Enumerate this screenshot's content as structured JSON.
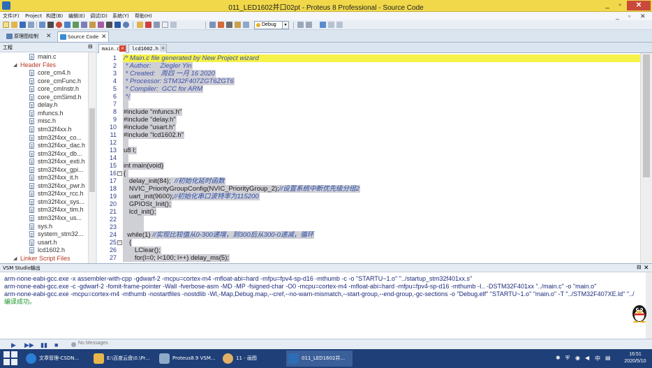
{
  "window": {
    "title": "011_LED1602并口02pt - Proteus 8 Professional - Source Code",
    "min": "_",
    "max": "▫",
    "close": "✕"
  },
  "menu": {
    "items": [
      "文件(F)",
      "Project",
      "构建(B)",
      "编辑(E)",
      "调试(D)",
      "系统(Y)",
      "帮助(H)"
    ],
    "mdi": [
      "_",
      "▫",
      "✕"
    ]
  },
  "toolbar": {
    "dropdown": "Debug",
    "arrow": "▾"
  },
  "doctabs": [
    {
      "label": "原理图绘制",
      "close": "✕",
      "color": "#5a7fb3"
    },
    {
      "label": "Source Code",
      "close": "✕",
      "color": "#3a8bd0"
    }
  ],
  "project": {
    "header": "工程",
    "pin": "⊟",
    "items": [
      {
        "label": "main.c",
        "type": "file",
        "indent": 0
      },
      {
        "label": "Header Files",
        "type": "folder",
        "indent": 0
      },
      {
        "label": "core_cm4.h",
        "type": "file",
        "indent": 1
      },
      {
        "label": "core_cmFunc.h",
        "type": "file",
        "indent": 1
      },
      {
        "label": "core_cmInstr.h",
        "type": "file",
        "indent": 1
      },
      {
        "label": "core_cmSimd.h",
        "type": "file",
        "indent": 1
      },
      {
        "label": "delay.h",
        "type": "file",
        "indent": 1
      },
      {
        "label": "mfuncs.h",
        "type": "file",
        "indent": 1
      },
      {
        "label": "misc.h",
        "type": "file",
        "indent": 1
      },
      {
        "label": "stm32f4xx.h",
        "type": "file",
        "indent": 1
      },
      {
        "label": "stm32f4xx_co...",
        "type": "file",
        "indent": 1
      },
      {
        "label": "stm32f4xx_dac.h",
        "type": "file",
        "indent": 1
      },
      {
        "label": "stm32f4xx_db...",
        "type": "file",
        "indent": 1
      },
      {
        "label": "stm32f4xx_exti.h",
        "type": "file",
        "indent": 1
      },
      {
        "label": "stm32f4xx_gpi...",
        "type": "file",
        "indent": 1
      },
      {
        "label": "stm32f4xx_it.h",
        "type": "file",
        "indent": 1
      },
      {
        "label": "stm32f4xx_pwr.h",
        "type": "file",
        "indent": 1
      },
      {
        "label": "stm32f4xx_rcc.h",
        "type": "file",
        "indent": 1
      },
      {
        "label": "stm32f4xx_sys...",
        "type": "file",
        "indent": 1
      },
      {
        "label": "stm32f4xx_tim.h",
        "type": "file",
        "indent": 1
      },
      {
        "label": "stm32f4xx_us...",
        "type": "file",
        "indent": 1
      },
      {
        "label": "sys.h",
        "type": "file",
        "indent": 1
      },
      {
        "label": "system_stm32...",
        "type": "file",
        "indent": 1
      },
      {
        "label": "usart.h",
        "type": "file",
        "indent": 1
      },
      {
        "label": "lcd1602.h",
        "type": "file",
        "indent": 1
      },
      {
        "label": "Linker Script Files",
        "type": "folder",
        "indent": 0
      }
    ]
  },
  "editor_tabs": [
    {
      "label": "main.c",
      "close": "✕",
      "active": true
    },
    {
      "label": "lcd1602.h",
      "close": "✕",
      "active": false
    }
  ],
  "code": [
    {
      "n": "1",
      "text": "/* Main.c file generated by New Project wizard",
      "k": "cm",
      "cur": true
    },
    {
      "n": "2",
      "text": " * Author:     Ziegler Yin",
      "k": "cm"
    },
    {
      "n": "3",
      "text": " * Created:   周四 一月 16 2020",
      "k": "cm"
    },
    {
      "n": "4",
      "text": " * Processor: STM32F407ZGT6ZGT6",
      "k": "cm"
    },
    {
      "n": "5",
      "text": " * Compiler:  GCC for ARM",
      "k": "cm"
    },
    {
      "n": "6",
      "text": " */",
      "k": "cm"
    },
    {
      "n": "7",
      "text": "",
      "k": "nm"
    },
    {
      "n": "8",
      "text": "#include \"mfuncs.h\"",
      "k": "pp"
    },
    {
      "n": "9",
      "text": "#include \"delay.h\"",
      "k": "pp"
    },
    {
      "n": "10",
      "text": "#include \"usart.h\"",
      "k": "pp"
    },
    {
      "n": "11",
      "text": "#include \"lcd1602.h\"",
      "k": "pp"
    },
    {
      "n": "12",
      "text": "",
      "k": "nm"
    },
    {
      "n": "13",
      "text": "u8 l;",
      "k": "nm"
    },
    {
      "n": "14",
      "text": "",
      "k": "nm"
    },
    {
      "n": "15",
      "text": "int main(void)",
      "k": "nm"
    },
    {
      "n": "16",
      "text": "{",
      "k": "nm",
      "fold": "⊟"
    },
    {
      "n": "17",
      "text": "   delay_init(84);  //初始化延时函数",
      "k": "mx"
    },
    {
      "n": "18",
      "text": "   NVIC_PriorityGroupConfig(NVIC_PriorityGroup_2);//设置系统中断优先级分组2",
      "k": "mx"
    },
    {
      "n": "19",
      "text": "   uart_init(9600);//初始化串口波特率为115200",
      "k": "mx"
    },
    {
      "n": "20",
      "text": "   GPIOSt_Init();",
      "k": "nm"
    },
    {
      "n": "21",
      "text": "   lcd_init();",
      "k": "nm"
    },
    {
      "n": "22",
      "text": "",
      "k": "nm"
    },
    {
      "n": "23",
      "text": "",
      "k": "nm"
    },
    {
      "n": "24",
      "text": "  while(1) //实现比较值从0-300递增，到300后从300-0递减，循环",
      "k": "mx"
    },
    {
      "n": "25",
      "text": "   {",
      "k": "nm",
      "fold": "⊟"
    },
    {
      "n": "26",
      "text": "      LClear();",
      "k": "nm"
    },
    {
      "n": "27",
      "text": "      for(l=0; l<100; l++) delay_ms(5);",
      "k": "nm"
    }
  ],
  "output": {
    "header": "VSM Studio输出",
    "pin": "⊟",
    "close": "✕",
    "lines": [
      "arm-none-eabi-gcc.exe -x assembler-with-cpp -gdwarf-2 -mcpu=cortex-m4 -mfloat-abi=hard -mfpu=fpv4-sp-d16 -mthumb -c  -o \"STARTU~1.o\" \"../startup_stm32f401xx.s\"",
      "arm-none-eabi-gcc.exe -c -gdwarf-2 -fomit-frame-pointer -Wall -fverbose-asm -MD -MP -fsigned-char -O0 -mcpu=cortex-m4 -mfloat-abi=hard -mfpu=fpv4-sp-d16 -mthumb -I.. -DSTM32F401xx   \"../main.c\" -o \"main.o\"",
      "arm-none-eabi-gcc.exe -mcpu=cortex-m4 -mthumb -nostartfiles -nostdlib  -Wl,-Map,Debug.map,--cref,--no-warn-mismatch,--start-group,--end-group,-gc-sections -o \"Debug.elf\" \"STARTU~1.o\" \"main.o\" -T \"../STM32F407XE.ld\" \"../"
    ],
    "success": "编译成功。"
  },
  "outbar": {
    "buttons": [
      "▶",
      "▶▶",
      "▮▮",
      "■"
    ],
    "messages": "No Messages"
  },
  "taskbar": {
    "tasks": [
      {
        "label": "文章管理-CSDN...",
        "color": "#2b7fd6"
      },
      {
        "label": "E:\\百度云盘\\0.\\Pr...",
        "color": "#e8b64a"
      },
      {
        "label": "Proteus8.9 VSM...",
        "color": "#8fa9c9"
      },
      {
        "label": "11 - 画图",
        "color": "#e0b066"
      },
      {
        "label": "011_LED1602并...",
        "color": "#2d6db5"
      }
    ],
    "time": "16:51",
    "date": "2020/5/10",
    "ime": "中"
  }
}
